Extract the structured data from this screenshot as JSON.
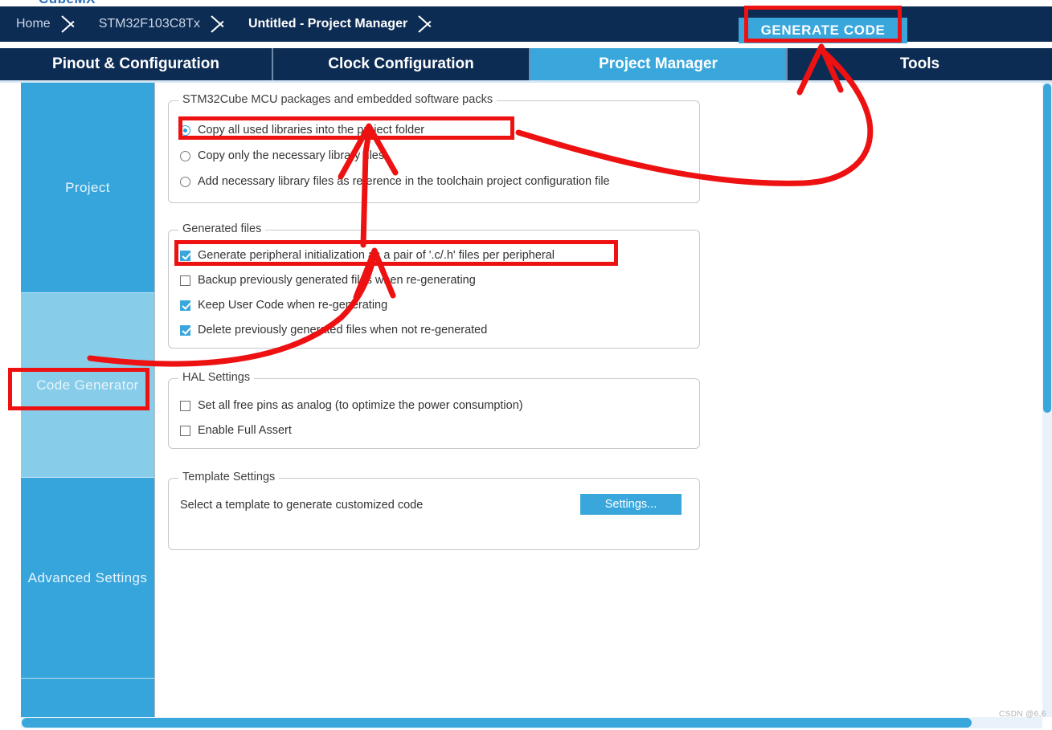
{
  "app": {
    "title_partial": "CubeMX"
  },
  "breadcrumb": {
    "items": [
      {
        "label": "Home",
        "active": false
      },
      {
        "label": "STM32F103C8Tx",
        "active": false
      },
      {
        "label": "Untitled - Project Manager",
        "active": true
      }
    ],
    "generate_code_label": "GENERATE CODE"
  },
  "tabs": [
    {
      "label": "Pinout & Configuration",
      "active": false
    },
    {
      "label": "Clock Configuration",
      "active": false
    },
    {
      "label": "Project Manager",
      "active": true
    },
    {
      "label": "Tools",
      "active": false
    }
  ],
  "sidebar": {
    "items": [
      {
        "label": "Project",
        "selected": false
      },
      {
        "label": "Code Generator",
        "selected": true
      },
      {
        "label": "Advanced Settings",
        "selected": false
      },
      {
        "label": "",
        "selected": false
      }
    ]
  },
  "groups": {
    "mcu_packages": {
      "title": "STM32Cube MCU packages and embedded software packs",
      "options": [
        {
          "label": "Copy all used libraries into the project folder",
          "checked": true
        },
        {
          "label": "Copy only the necessary library files",
          "checked": false
        },
        {
          "label": "Add necessary library files as reference in the toolchain project configuration file",
          "checked": false
        }
      ]
    },
    "generated_files": {
      "title": "Generated files",
      "options": [
        {
          "label": "Generate peripheral initialization as a pair of '.c/.h' files per peripheral",
          "checked": true
        },
        {
          "label": "Backup previously generated files when re-generating",
          "checked": false
        },
        {
          "label": "Keep User Code when re-generating",
          "checked": true
        },
        {
          "label": "Delete previously generated files when not re-generated",
          "checked": true
        }
      ]
    },
    "hal_settings": {
      "title": "HAL Settings",
      "options": [
        {
          "label": "Set all free pins as analog (to optimize the power consumption)",
          "checked": false
        },
        {
          "label": "Enable Full Assert",
          "checked": false
        }
      ]
    },
    "template_settings": {
      "title": "Template Settings",
      "description": "Select a template to generate customized code",
      "button_label": "Settings..."
    }
  },
  "watermark": "CSDN @6,6",
  "colors": {
    "dark_navy": "#0d2c54",
    "accent_blue": "#3aa7dc",
    "sidebar_selected": "#87cdea",
    "annotation_red": "#ee1111"
  }
}
